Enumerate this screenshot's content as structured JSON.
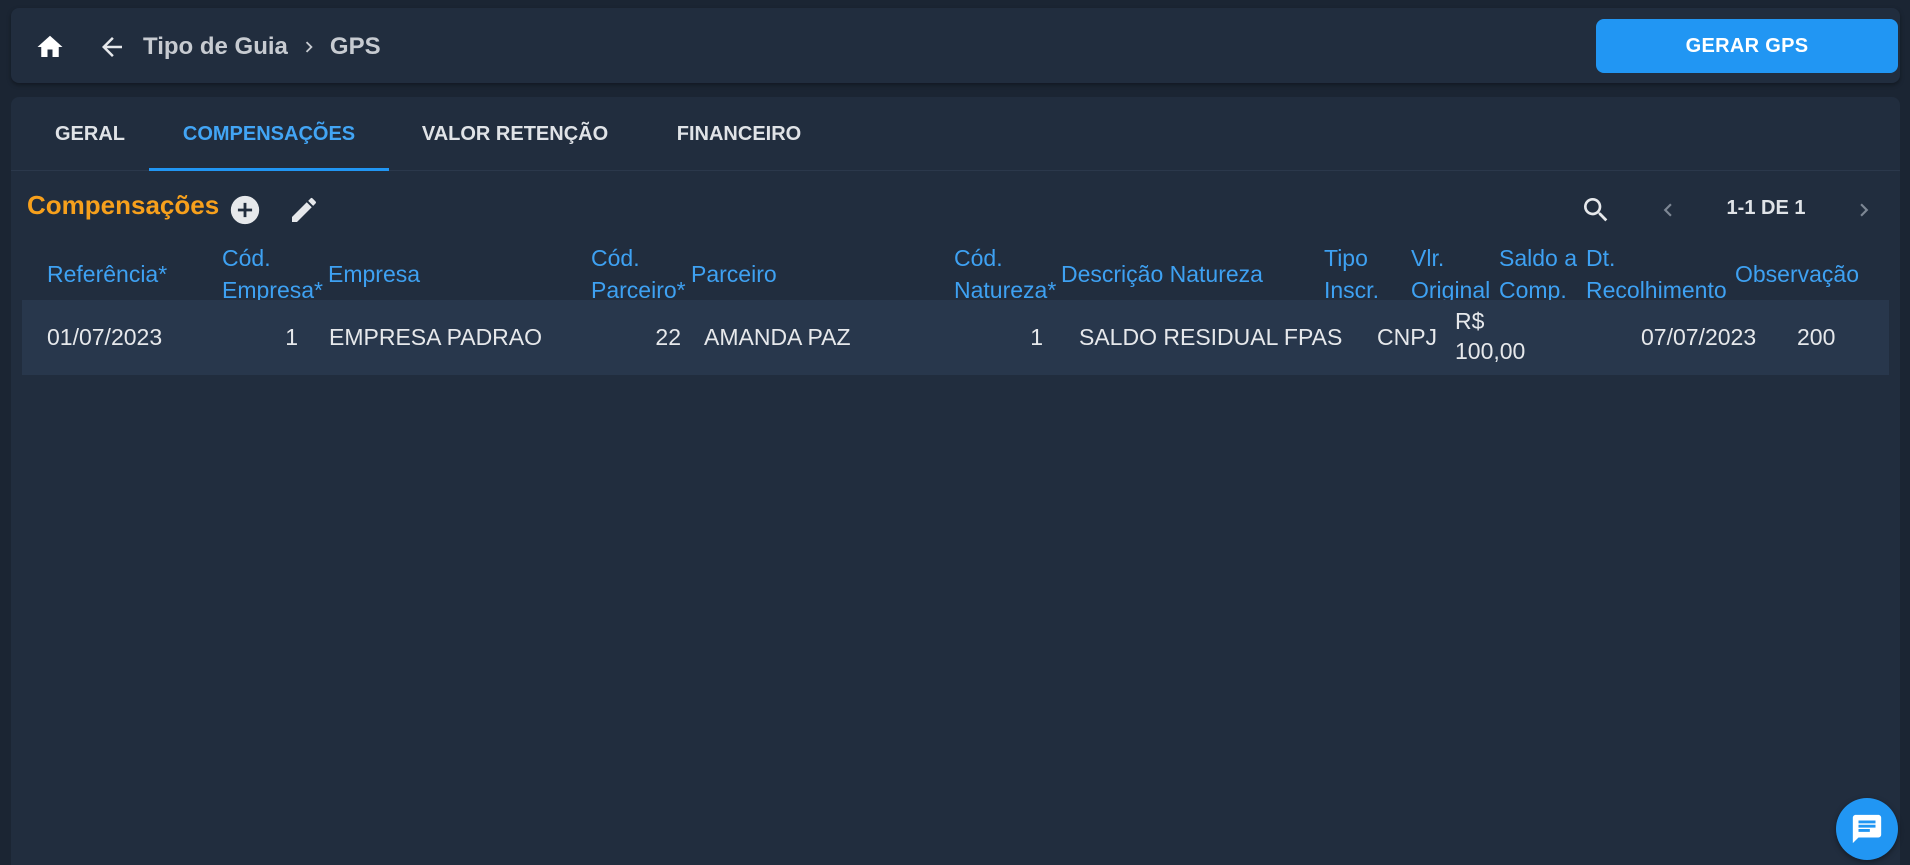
{
  "breadcrumb": {
    "parent": "Tipo de Guia",
    "current": "GPS"
  },
  "toolbar": {
    "primary_label": "GERAR GPS"
  },
  "tabs": [
    {
      "label": "GERAL",
      "active": false
    },
    {
      "label": "COMPENSAÇÕES",
      "active": true
    },
    {
      "label": "VALOR RETENÇÃO",
      "active": false
    },
    {
      "label": "FINANCEIRO",
      "active": false
    }
  ],
  "section": {
    "title": "Compensações"
  },
  "pager": {
    "text": "1-1 DE 1"
  },
  "columns": {
    "referencia": "Referência*",
    "cod_empresa_1": "Cód.",
    "cod_empresa_2": "Empresa*",
    "empresa": "Empresa",
    "cod_parceiro_1": "Cód.",
    "cod_parceiro_2": "Parceiro*",
    "parceiro": "Parceiro",
    "cod_natureza_1": "Cód.",
    "cod_natureza_2": "Natureza*",
    "descricao_natureza": "Descrição Natureza",
    "tipo_inscr_1": "Tipo",
    "tipo_inscr_2": "Inscr.",
    "vlr_original_1": "Vlr.",
    "vlr_original_2": "Original",
    "saldo_comp_1": "Saldo a",
    "saldo_comp_2": "Comp.",
    "dt_recolhimento_1": "Dt.",
    "dt_recolhimento_2": "Recolhimento",
    "observacao": "Observação"
  },
  "rows": [
    {
      "referencia": "01/07/2023",
      "cod_empresa": "1",
      "empresa": "EMPRESA PADRAO",
      "cod_parceiro": "22",
      "parceiro": "AMANDA PAZ",
      "cod_natureza": "1",
      "descricao_natureza": "SALDO RESIDUAL FPAS",
      "tipo_inscr": "CNPJ",
      "vlr_original_1": "R$",
      "vlr_original_2": "100,00",
      "saldo_comp": "",
      "dt_recolhimento": "07/07/2023",
      "observacao": "200"
    }
  ],
  "icons": {
    "home": "home-icon",
    "back": "arrow-left-icon",
    "chevron": "chevron-right-icon",
    "add": "add-circle-icon",
    "edit": "pencil-icon",
    "search": "search-icon",
    "prev": "chevron-left-icon",
    "next": "chevron-right-icon",
    "chat": "chat-icon"
  },
  "colors": {
    "background": "#1b2533",
    "surface": "#212d3e",
    "accent": "#2196f3",
    "header_text": "#3ea1f2",
    "title_orange": "#f7a01c",
    "row_bg": "#28374c"
  }
}
